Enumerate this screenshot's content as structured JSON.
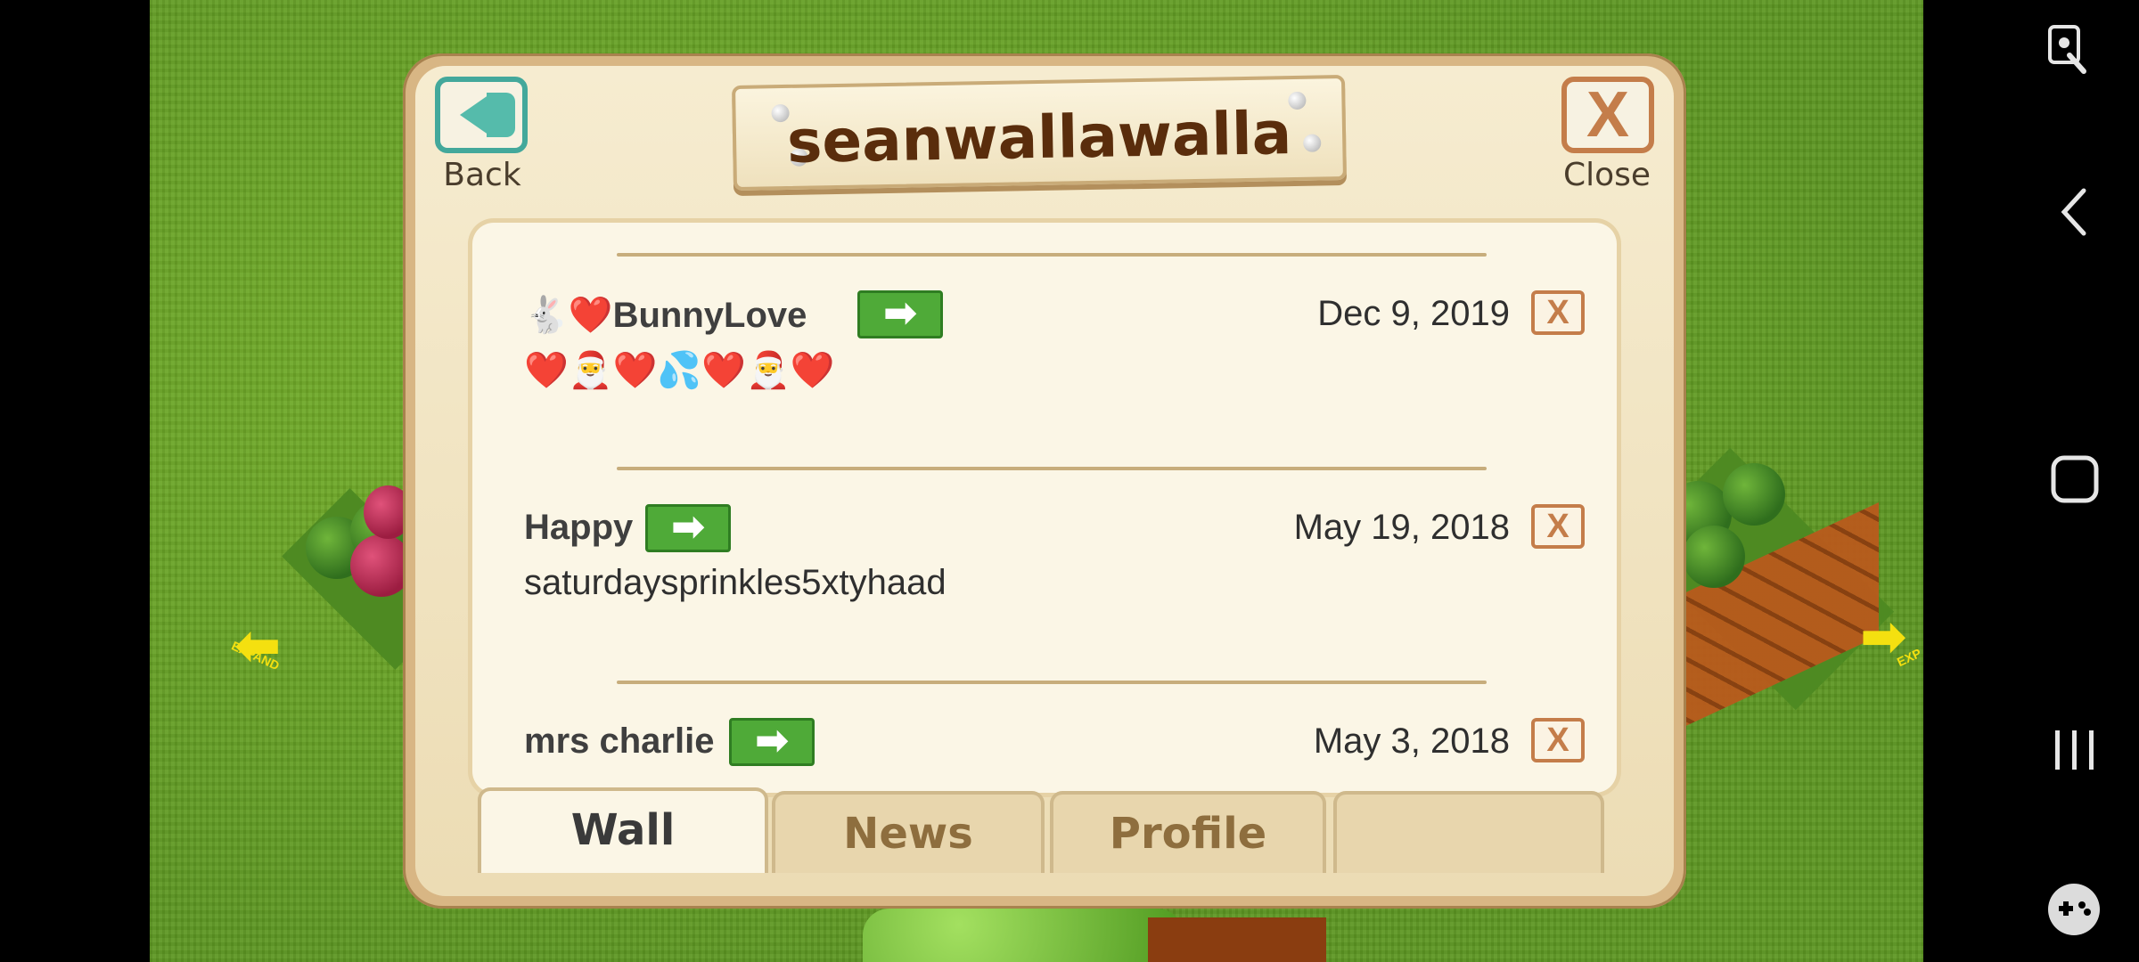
{
  "dialog": {
    "title": "seanwallawalla",
    "back_label": "Back",
    "close_label": "Close",
    "close_glyph": "X"
  },
  "posts": [
    {
      "author": "🐇❤️BunnyLove",
      "date": "Dec 9, 2019",
      "message": "❤️🎅❤️💦❤️🎅❤️"
    },
    {
      "author": "Happy",
      "date": "May 19, 2018",
      "message": "saturdaysprinkles5xtyhaad"
    },
    {
      "author": "mrs charlie",
      "date": "May 3, 2018",
      "message": ""
    }
  ],
  "post_actions": {
    "go_glyph": "➡",
    "delete_glyph": "X"
  },
  "tabs": [
    {
      "label": "Wall",
      "active": true
    },
    {
      "label": "News",
      "active": false
    },
    {
      "label": "Profile",
      "active": false
    },
    {
      "label": "",
      "active": false
    }
  ],
  "game": {
    "expand_left": "EXPAND",
    "expand_right": "EXP"
  },
  "colors": {
    "grass": "#6aa526",
    "dialog_frame": "#d8b684",
    "go_button": "#4faa38",
    "delete_border": "#c47d4a",
    "back_border": "#43a89b"
  },
  "navbar_icons": [
    "screen-lock-icon",
    "back-icon",
    "home-icon",
    "recents-icon",
    "game-controller-icon"
  ]
}
